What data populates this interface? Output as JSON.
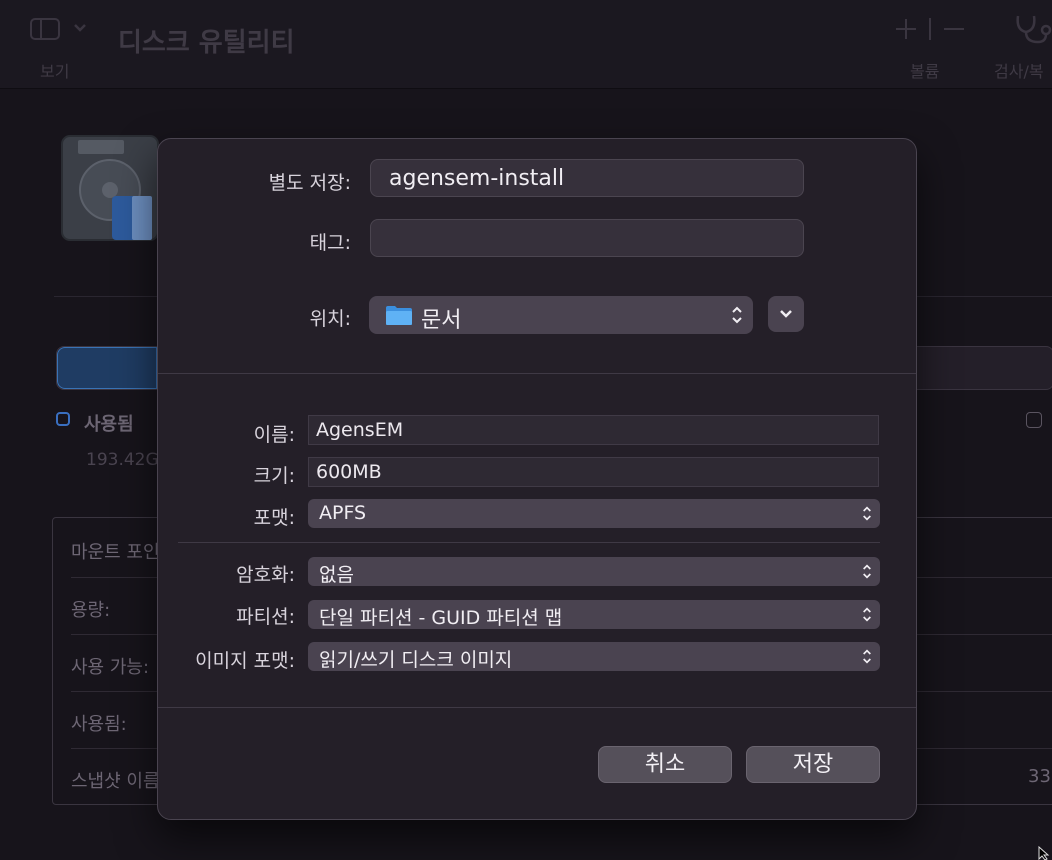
{
  "background_window": {
    "toolbar": {
      "view_label": "보기",
      "title": "디스크 유틸리티",
      "volume_label": "볼륨",
      "first_aid_label": "검사/복"
    },
    "usage": {
      "used_label": "사용됨",
      "used_value": "193.42G",
      "bar_fill_fraction": 0.1
    },
    "info_rows": [
      "마운트 포인",
      "용량:",
      "사용 가능:",
      "사용됨:",
      "스냅샷 이름"
    ],
    "info_right_value": "33"
  },
  "dialog": {
    "save_as": {
      "label": "별도 저장:",
      "value": "agensem-install"
    },
    "tags": {
      "label": "태그:",
      "value": ""
    },
    "where": {
      "label": "위치:",
      "value": "문서"
    },
    "name": {
      "label": "이름:",
      "value": "AgensEM"
    },
    "size": {
      "label": "크기:",
      "value": "600MB"
    },
    "format": {
      "label": "포맷:",
      "value": "APFS"
    },
    "encryption": {
      "label": "암호화:",
      "value": "없음"
    },
    "partition": {
      "label": "파티션:",
      "value": "단일 파티션 - GUID 파티션 맵"
    },
    "image_format": {
      "label": "이미지 포맷:",
      "value": "읽기/쓰기 디스크 이미지"
    },
    "cancel_label": "취소",
    "save_label": "저장"
  },
  "colors": {
    "sheet_background": "#241f28",
    "popup_background": "#4a4350",
    "folder_blue": "#4aa3f0"
  }
}
